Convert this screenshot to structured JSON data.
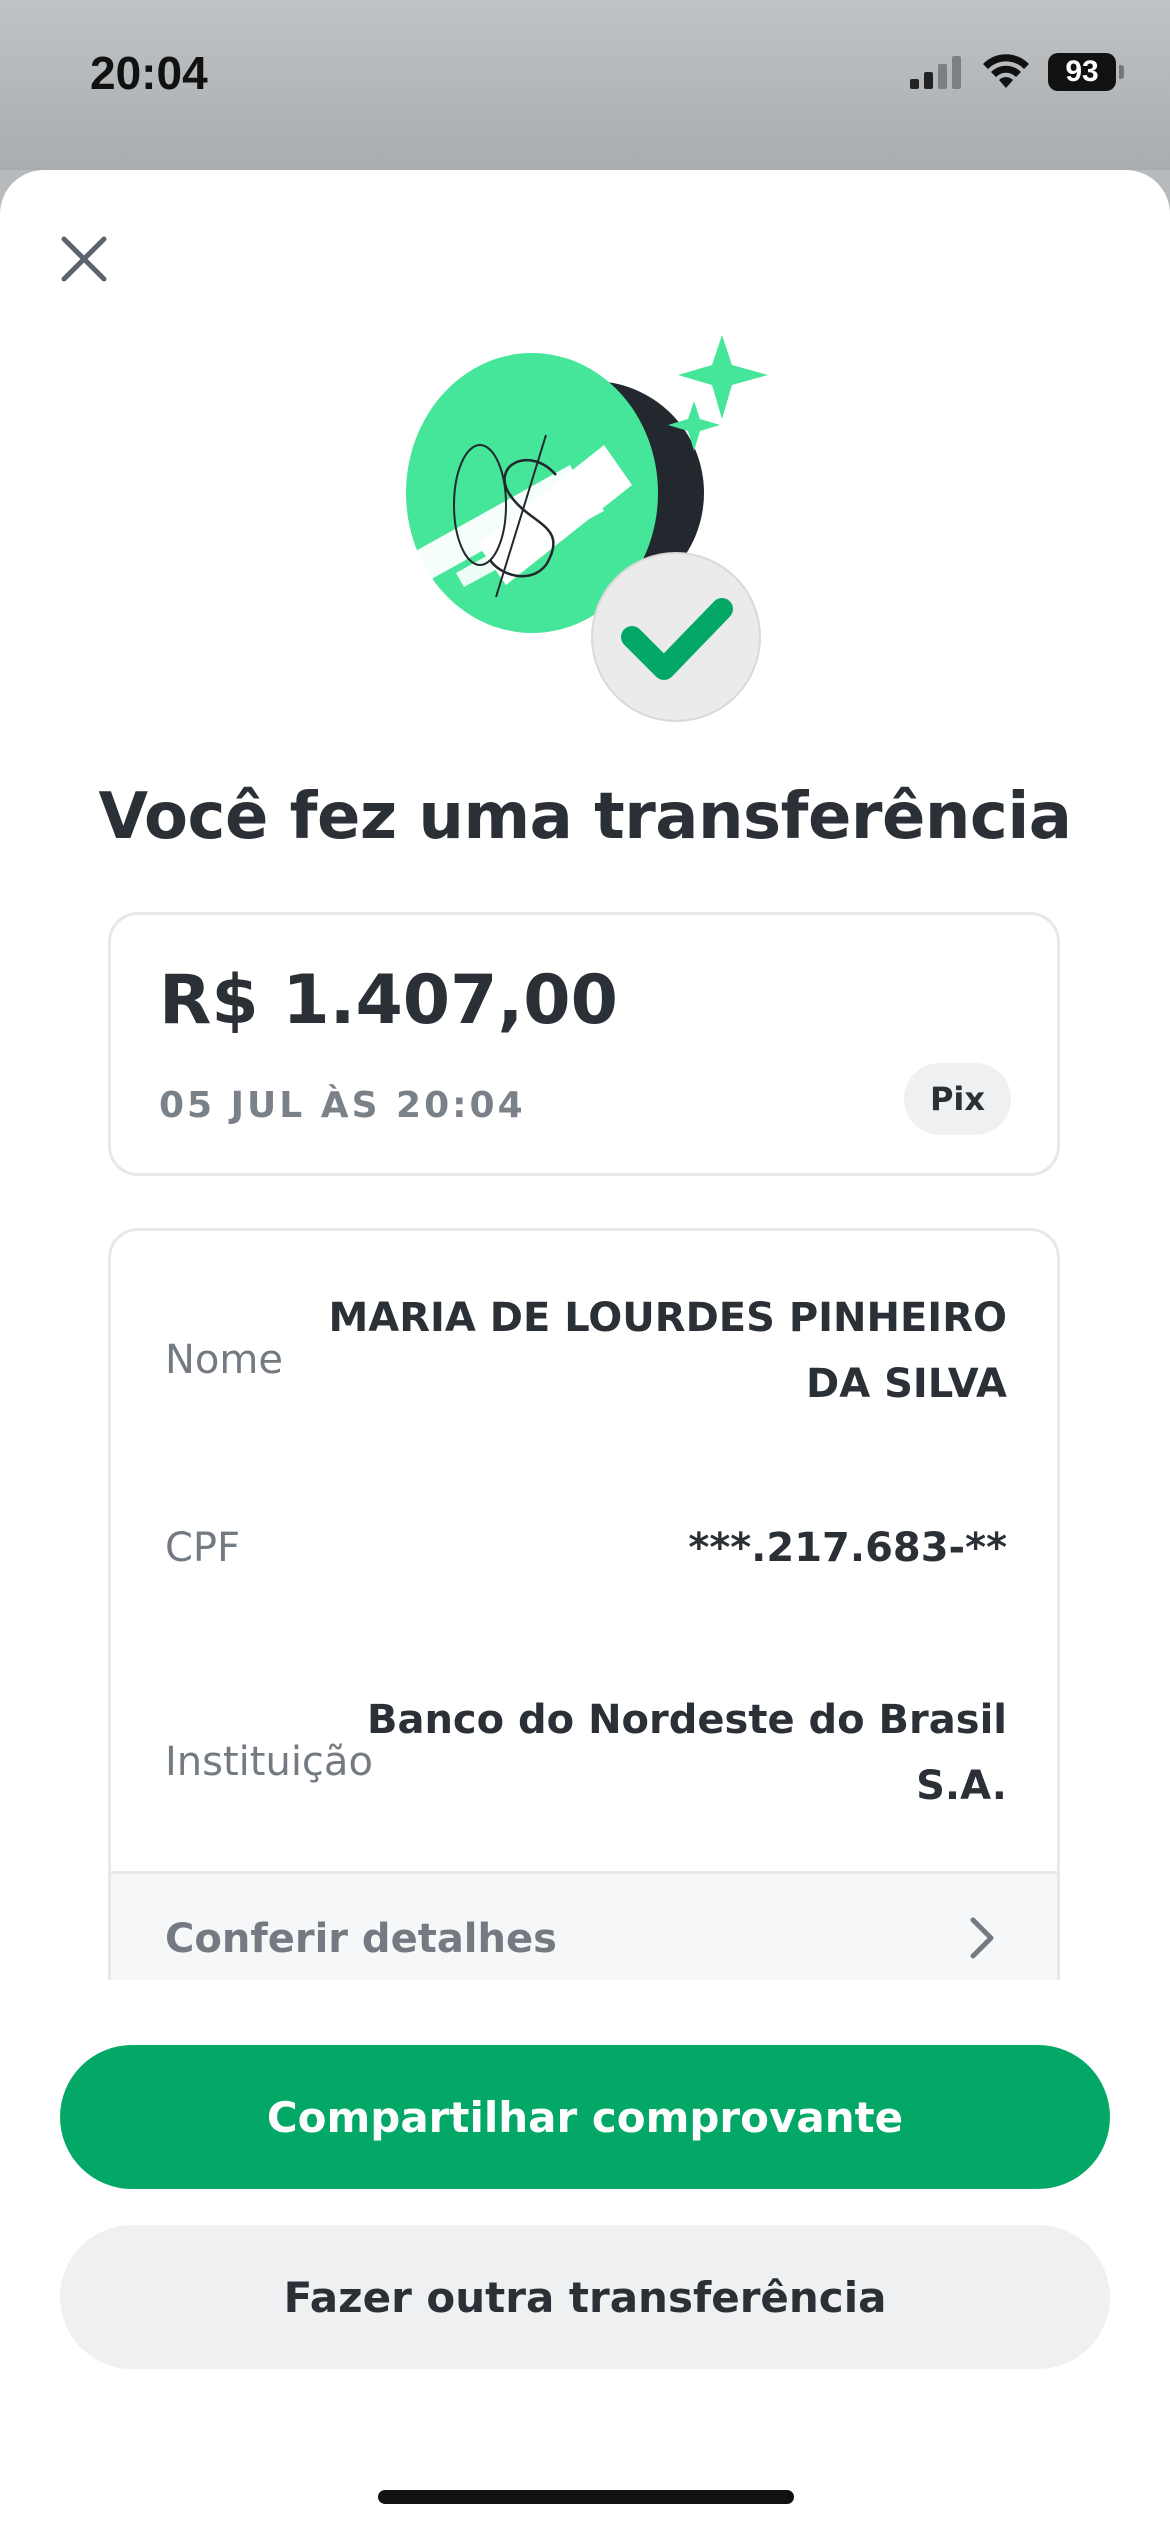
{
  "status_bar": {
    "time": "20:04",
    "battery": "93"
  },
  "title": "Você fez uma transferência",
  "transfer": {
    "amount": "R$ 1.407,00",
    "date": "05 JUL ÀS 20:04",
    "method": "Pix"
  },
  "details": {
    "rows": [
      {
        "label": "Nome",
        "value_line1": "MARIA DE LOURDES PINHEIRO",
        "value_line2": "DA SILVA"
      },
      {
        "label": "CPF",
        "value_line1": "***.217.683-**"
      },
      {
        "label": "Instituição",
        "value_line1": "Banco do Nordeste do Brasil",
        "value_line2": "S.A."
      }
    ],
    "footer_link": "Conferir detalhes"
  },
  "actions": {
    "primary": "Compartilhar comprovante",
    "secondary": "Fazer outra transferência"
  },
  "colors": {
    "brand_green": "#03a866",
    "illustration_green": "#45e69a",
    "text_dark": "#2b2f36",
    "text_muted": "#737a82"
  },
  "icons": [
    "signal-icon",
    "wifi-icon",
    "battery-icon",
    "close-icon",
    "success-check-icon",
    "chevron-right-icon"
  ]
}
